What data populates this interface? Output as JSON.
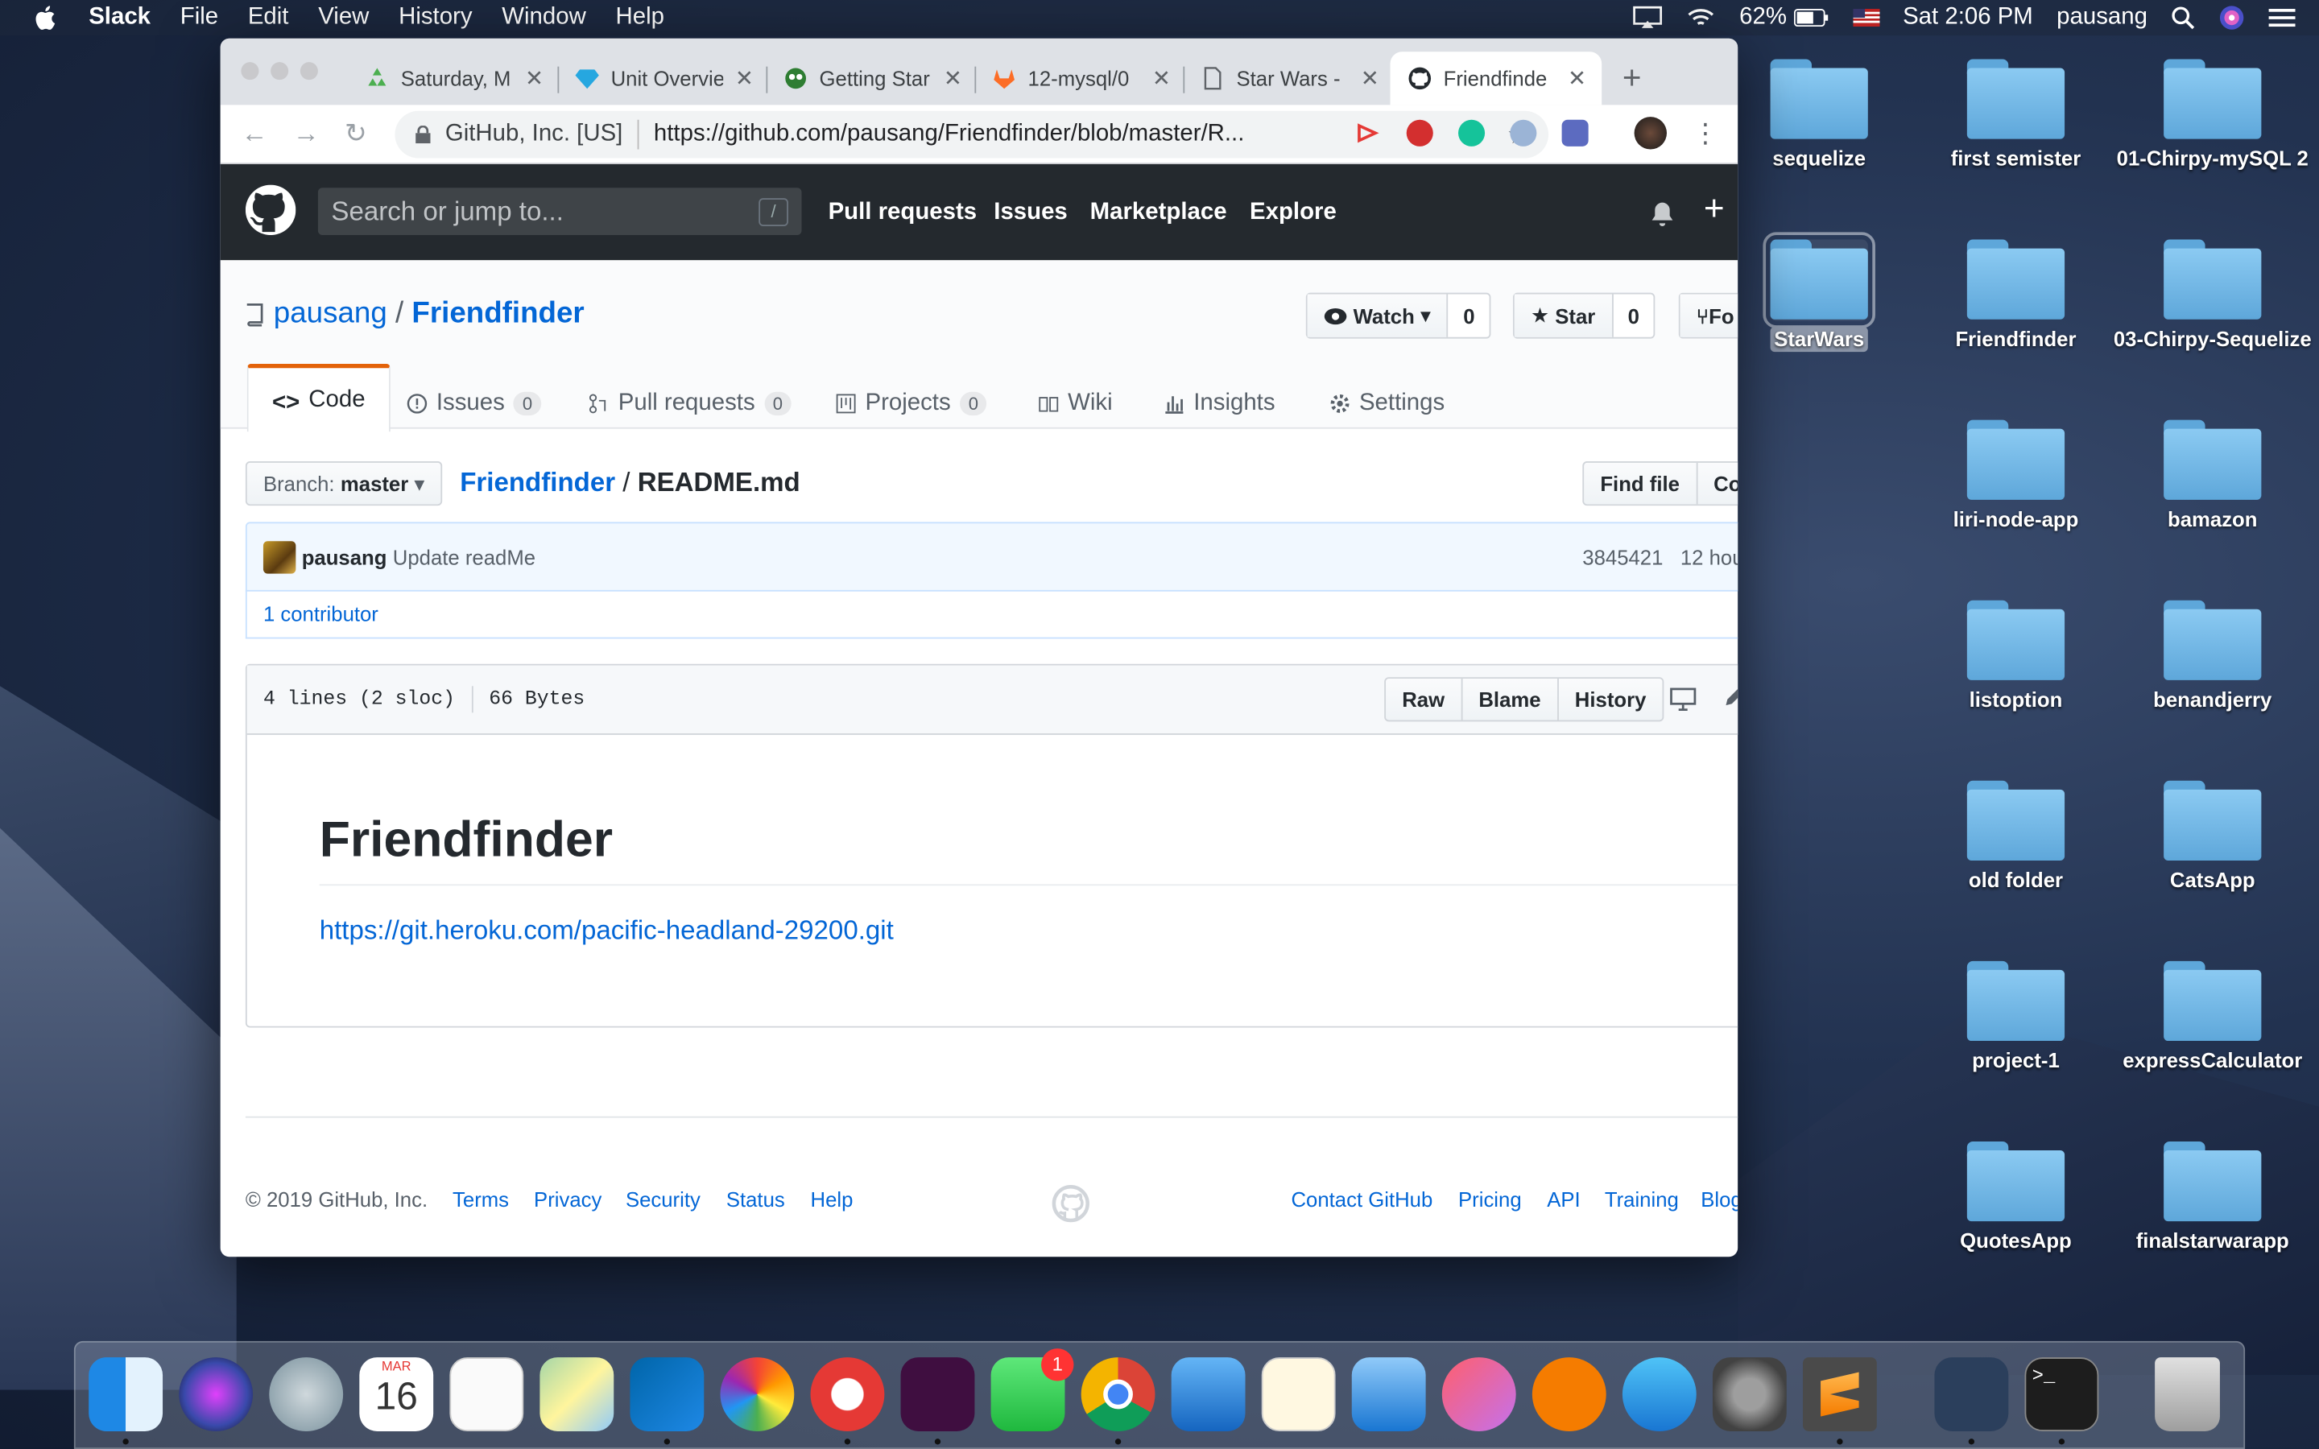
{
  "menubar": {
    "app": "Slack",
    "items": [
      "File",
      "Edit",
      "View",
      "History",
      "Window",
      "Help"
    ],
    "battery": "62%",
    "clock": "Sat 2:06 PM",
    "user": "pausang"
  },
  "browser": {
    "tabs": [
      {
        "title": "Saturday, M",
        "icon": "recycle-icon",
        "active": false
      },
      {
        "title": "Unit Overvie",
        "icon": "diamond-icon",
        "active": false
      },
      {
        "title": "Getting Star",
        "icon": "alien-icon",
        "active": false
      },
      {
        "title": "12-mysql/0",
        "icon": "gitlab-icon",
        "active": false
      },
      {
        "title": "Star Wars -",
        "icon": "page-icon",
        "active": false
      },
      {
        "title": "Friendfinde",
        "icon": "github-icon",
        "active": true
      }
    ],
    "url_org": "GitHub, Inc. [US]",
    "url": "https://github.com/pausang/Friendfinder/blob/master/R..."
  },
  "github": {
    "search_placeholder": "Search or jump to...",
    "search_hint": "/",
    "nav": [
      "Pull requests",
      "Issues",
      "Marketplace",
      "Explore"
    ],
    "owner": "pausang",
    "repo": "Friendfinder",
    "watch_label": "Watch",
    "watch_count": "0",
    "star_label": "Star",
    "star_count": "0",
    "fork_label": "Fo",
    "tabs": [
      {
        "label": "Code",
        "count": ""
      },
      {
        "label": "Issues",
        "count": "0"
      },
      {
        "label": "Pull requests",
        "count": "0"
      },
      {
        "label": "Projects",
        "count": "0"
      },
      {
        "label": "Wiki",
        "count": ""
      },
      {
        "label": "Insights",
        "count": ""
      },
      {
        "label": "Settings",
        "count": ""
      }
    ],
    "branch_prefix": "Branch:",
    "branch": "master",
    "crumb_repo": "Friendfinder",
    "crumb_file": "README.md",
    "find_file": "Find file",
    "copy_path": "Co",
    "commit": {
      "author": "pausang",
      "message": "Update readMe",
      "sha": "3845421",
      "time": "12 hou"
    },
    "contributors": "1 contributor",
    "file_lines": "4 lines (2 sloc)",
    "file_size": "66 Bytes",
    "file_actions": [
      "Raw",
      "Blame",
      "History"
    ],
    "readme_title": "Friendfinder",
    "readme_link": "https://git.heroku.com/pacific-headland-29200.git",
    "footer_copy": "© 2019 GitHub, Inc.",
    "footer_left": [
      "Terms",
      "Privacy",
      "Security",
      "Status",
      "Help"
    ],
    "footer_right": [
      "Contact GitHub",
      "Pricing",
      "API",
      "Training",
      "Blog"
    ]
  },
  "desktop": {
    "folders": [
      "sequelize",
      "first semister",
      "01-Chirpy-mySQL 2",
      "StarWars",
      "Friendfinder",
      "03-Chirpy-Sequelize",
      "liri-node-app",
      "bamazon",
      "listoption",
      "benandjerry",
      "old folder",
      "CatsApp",
      "project-1",
      "expressCalculator",
      "QuotesApp",
      "finalstarwarapp"
    ]
  },
  "dock": {
    "calendar_month": "MAR",
    "calendar_day": "16",
    "facetime_badge": "1"
  },
  "colors": {
    "github_header": "#24292e",
    "link": "#0366d6",
    "tab_accent": "#e36209",
    "folder": "#6cb6e6"
  }
}
